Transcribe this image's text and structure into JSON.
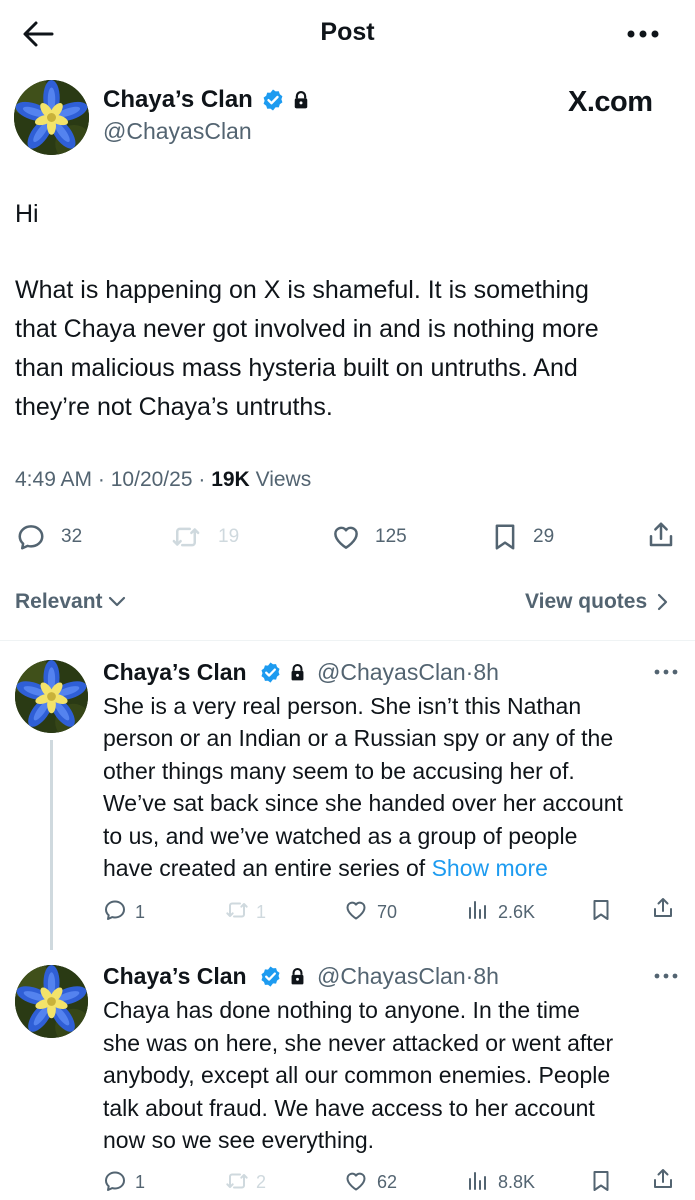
{
  "header": {
    "title": "Post"
  },
  "post": {
    "author_name": "Chaya’s Clan",
    "author_handle": "@ChayasClan",
    "watermark": "X.com",
    "text_greeting": "Hi",
    "text_lines": [
      "What is happening on X is shameful. It is something",
      "that Chaya never got involved in and is nothing more",
      "than malicious mass hysteria built on untruths. And",
      "they’re not Chaya’s untruths."
    ],
    "time": "4:49 AM",
    "date": "10/20/25",
    "views_count": "19K",
    "views_label": "Views",
    "separator": "·",
    "replies": "32",
    "reposts": "19",
    "likes": "125",
    "bookmarks": "29"
  },
  "filter": {
    "sort_label": "Relevant",
    "quotes_label": "View quotes"
  },
  "replies": [
    {
      "author_name": "Chaya’s Clan",
      "author_handle": "@ChayasClan",
      "time_ago": "8h",
      "lines": [
        "She is a very real person. She isn’t this Nathan",
        "person or an Indian or a Russian spy or any of the",
        "other things many seem to be accusing her of.",
        "We’ve sat back since she handed over her account",
        "to us, and we’ve watched as a group of people",
        "have created an entire series of"
      ],
      "show_more": "Show more",
      "replies": "1",
      "reposts": "1",
      "likes": "70",
      "views": "2.6K"
    },
    {
      "author_name": "Chaya’s Clan",
      "author_handle": "@ChayasClan",
      "time_ago": "8h",
      "lines": [
        "Chaya has done nothing to anyone. In the time",
        "she was on here, she never attacked or went after",
        "anybody, except all our common enemies. People",
        "talk about fraud. We have access to her account",
        "now so we see everything."
      ],
      "replies": "1",
      "reposts": "2",
      "likes": "62",
      "views": "8.8K"
    }
  ],
  "colors": {
    "link": "#1d9bf0",
    "verified": "#1d9bf0",
    "muted": "#536471",
    "faint": "#cfd9de"
  }
}
